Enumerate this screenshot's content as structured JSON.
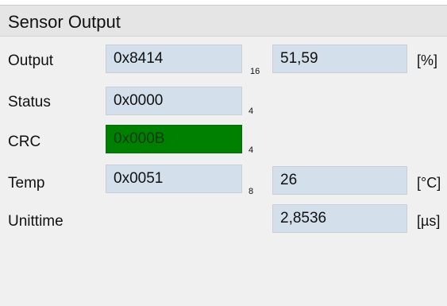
{
  "panel": {
    "title": "Sensor Output"
  },
  "rows": {
    "output": {
      "label": "Output",
      "hex_value": "0x8414",
      "bits": "16",
      "value": "51,59",
      "unit": "[%]"
    },
    "status": {
      "label": "Status",
      "hex_value": "0x0000",
      "bits": "4"
    },
    "crc": {
      "label": "CRC",
      "hex_value": "0x000B",
      "bits": "4",
      "highlight_color": "#008000"
    },
    "temp": {
      "label": "Temp",
      "hex_value": "0x0051",
      "bits": "8",
      "value": "26",
      "unit": "[°C]"
    },
    "unittime": {
      "label": "Unittime",
      "value": "2,8536",
      "unit": "[µs]"
    }
  },
  "colors": {
    "field_background": "#d3dfeb",
    "panel_background": "#f0f0f0",
    "header_background": "#e5e5e5"
  }
}
